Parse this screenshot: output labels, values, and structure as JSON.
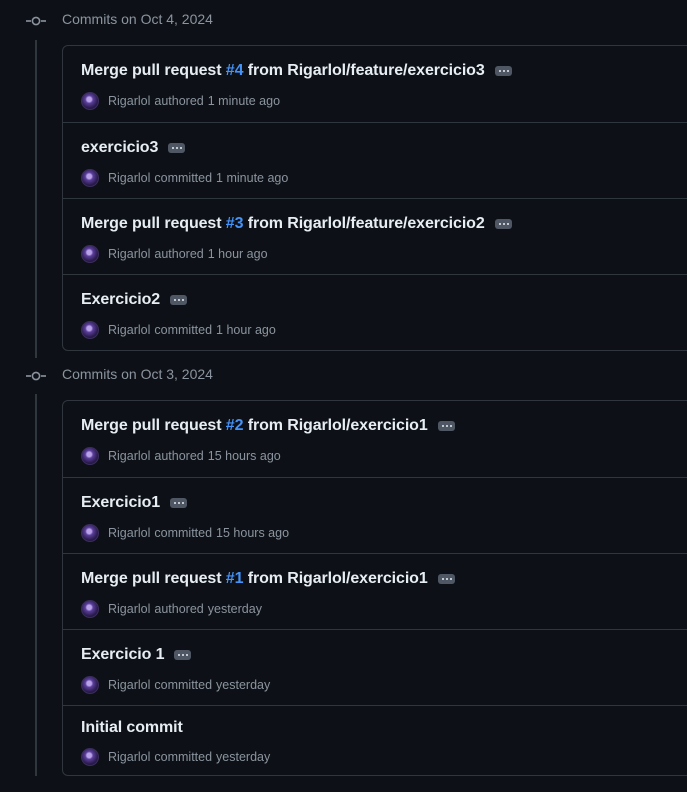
{
  "groups": [
    {
      "title": "Commits on Oct 4, 2024",
      "commits": [
        {
          "prefix": "Merge pull request ",
          "pr": "#4",
          "suffix": " from Rigarlol/feature/exercicio3",
          "author": "Rigarlol",
          "action": "authored",
          "time": "1 minute ago"
        },
        {
          "prefix": "exercicio3",
          "pr": "",
          "suffix": "",
          "author": "Rigarlol",
          "action": "committed",
          "time": "1 minute ago"
        },
        {
          "prefix": "Merge pull request ",
          "pr": "#3",
          "suffix": " from Rigarlol/feature/exercicio2",
          "author": "Rigarlol",
          "action": "authored",
          "time": "1 hour ago"
        },
        {
          "prefix": "Exercicio2",
          "pr": "",
          "suffix": "",
          "author": "Rigarlol",
          "action": "committed",
          "time": "1 hour ago"
        }
      ]
    },
    {
      "title": "Commits on Oct 3, 2024",
      "commits": [
        {
          "prefix": "Merge pull request ",
          "pr": "#2",
          "suffix": " from Rigarlol/exercicio1",
          "author": "Rigarlol",
          "action": "authored",
          "time": "15 hours ago"
        },
        {
          "prefix": "Exercicio1",
          "pr": "",
          "suffix": "",
          "author": "Rigarlol",
          "action": "committed",
          "time": "15 hours ago"
        },
        {
          "prefix": "Merge pull request ",
          "pr": "#1",
          "suffix": " from Rigarlol/exercicio1",
          "author": "Rigarlol",
          "action": "authored",
          "time": "yesterday"
        },
        {
          "prefix": "Exercicio 1",
          "pr": "",
          "suffix": "",
          "author": "Rigarlol",
          "action": "committed",
          "time": "yesterday"
        },
        {
          "prefix": "Initial commit",
          "pr": "",
          "suffix": "",
          "author": "Rigarlol",
          "action": "committed",
          "time": "yesterday",
          "no_menu": true
        }
      ]
    }
  ],
  "colors": {
    "background": "#0d1117",
    "border": "#30363d",
    "text": "#e6edf3",
    "muted": "#8b949e",
    "link": "#4493f8"
  },
  "icons": {
    "group": "git-commit-icon",
    "menu": "kebab-horizontal-icon",
    "avatar": "user-avatar"
  }
}
